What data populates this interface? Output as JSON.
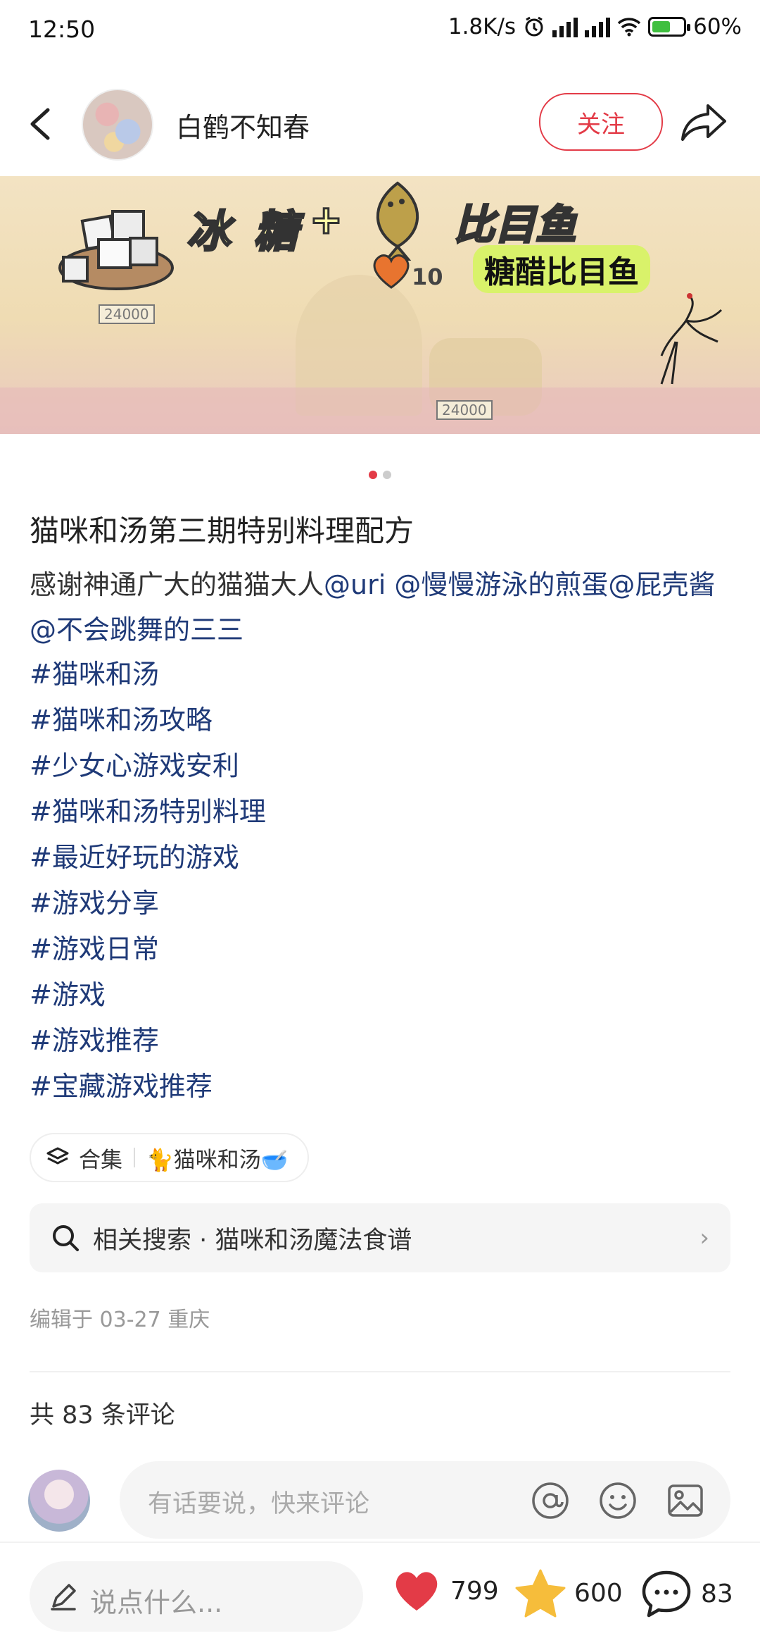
{
  "status_bar": {
    "time": "12:50",
    "speed": "1.8K/s",
    "battery": "60%",
    "battery_level": 0.6
  },
  "header": {
    "author": "白鹤不知春",
    "follow_label": "关注"
  },
  "banner": {
    "text_left": "冰 糖",
    "plus": "+",
    "text_right": "比目鱼",
    "dish": "糖醋比目鱼",
    "heart_value": "10",
    "price_a": "24000",
    "price_b": "24000"
  },
  "carousel": {
    "count": 2,
    "active": 1
  },
  "post": {
    "title": "猫咪和汤第三期特别料理配方",
    "body_prefix": "感谢神通广大的猫猫大人",
    "mention_1": "@uri",
    "mention_2": "@慢慢游泳的煎蛋",
    "mention_3": "@屁壳酱",
    "mention_4": "@不会跳舞的三三",
    "tags": [
      "#猫咪和汤",
      "#猫咪和汤攻略",
      "#少女心游戏安利",
      "#猫咪和汤特别料理",
      "#最近好玩的游戏",
      "#游戏分享",
      "#游戏日常",
      "#游戏",
      "#游戏推荐",
      "#宝藏游戏推荐"
    ]
  },
  "collection": {
    "label": "合集",
    "name": "🐈猫咪和汤🥣"
  },
  "related_search": {
    "label": "相关搜索 · 猫咪和汤魔法食谱"
  },
  "meta": {
    "edited": "编辑于 03-27 重庆"
  },
  "comments": {
    "count_label": "共 83 条评论",
    "placeholder": "有话要说，快来评论"
  },
  "bottom_bar": {
    "say_placeholder": "说点什么...",
    "likes": "799",
    "stars": "600",
    "comments": "83"
  },
  "colors": {
    "accent": "#e33b47",
    "link": "#1f3a78",
    "star": "#f6bd3b"
  }
}
